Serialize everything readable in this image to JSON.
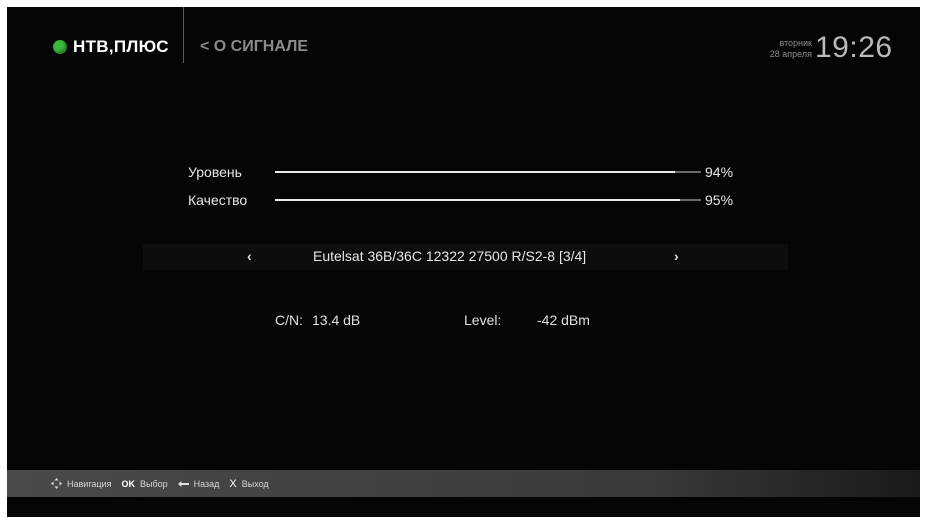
{
  "header": {
    "brand": "НТВ,ПЛЮС",
    "breadcrumb": "< О СИГНАЛЕ",
    "day": "вторник",
    "date": "28 апреля",
    "time": "19:26"
  },
  "signal": {
    "level": {
      "label": "Уровень",
      "value": "94%",
      "fraction": 0.94
    },
    "quality": {
      "label": "Качество",
      "value": "95%",
      "fraction": 0.95
    }
  },
  "transponder": {
    "prev": "‹",
    "next": "›",
    "label": "Eutelsat  36B/36C 12322 27500 R/S2-8 [3/4]"
  },
  "stats": {
    "cn_label": "C/N:",
    "cn_value": "13.4 dB",
    "level_label": "Level:",
    "level_value": "-42 dBm"
  },
  "hints": [
    {
      "icon": "dpad-icon",
      "label": "Навигация"
    },
    {
      "key": "OK",
      "label": "Выбор"
    },
    {
      "icon": "back-arrow-icon",
      "label": "Назад"
    },
    {
      "key": "X",
      "label": "Выход"
    }
  ],
  "colors": {
    "brand_dot": "#3cb83f",
    "background": "#050505"
  }
}
